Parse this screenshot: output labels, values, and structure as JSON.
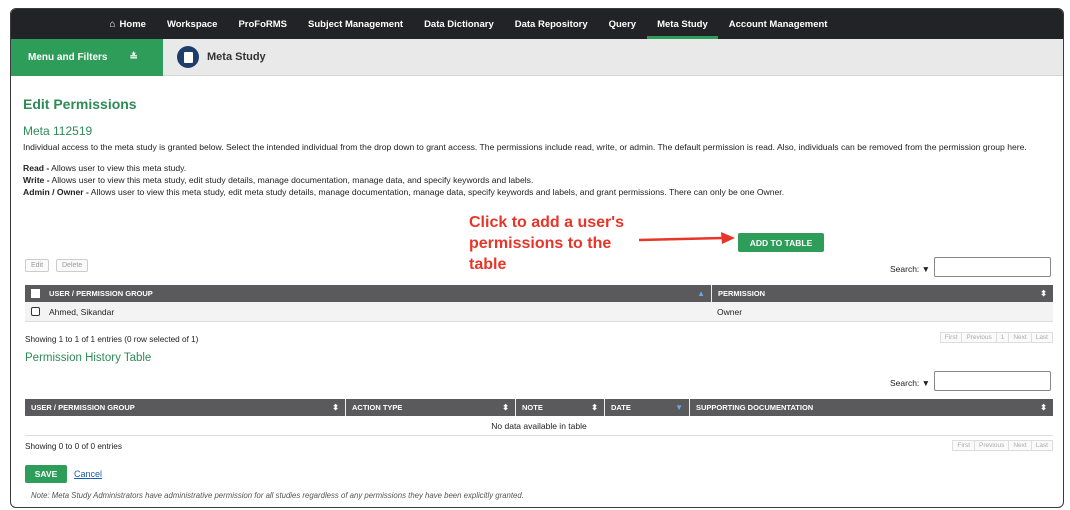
{
  "nav": {
    "items": [
      {
        "label": "Home",
        "icon": "home-icon",
        "active": false
      },
      {
        "label": "Workspace",
        "active": false
      },
      {
        "label": "ProFoRMS",
        "active": false
      },
      {
        "label": "Subject Management",
        "active": false
      },
      {
        "label": "Data Dictionary",
        "active": false
      },
      {
        "label": "Data Repository",
        "active": false
      },
      {
        "label": "Query",
        "active": false
      },
      {
        "label": "Meta Study",
        "active": true
      },
      {
        "label": "Account Management",
        "active": false
      }
    ]
  },
  "subbar": {
    "menu_filters_label": "Menu and Filters",
    "section_title": "Meta Study"
  },
  "page": {
    "title": "Edit Permissions",
    "meta_name": "Meta 112519",
    "description": "Individual access to the meta study is granted below. Select the intended individual from the drop down to grant access. The permissions include read, write, or admin. The default permission is read. Also, individuals can be removed from the permission group here.",
    "perm_read_term": "Read -",
    "perm_read_desc": " Allows user to view this meta study.",
    "perm_write_term": "Write -",
    "perm_write_desc": " Allows user to view this meta study, edit study details, manage documentation, manage data, and specify keywords and labels.",
    "perm_admin_term": "Admin / Owner -",
    "perm_admin_desc": " Allows user to view this meta study, edit meta study details, manage documentation, manage data, specify keywords and labels, and grant permissions. There can only be one Owner."
  },
  "annotation": {
    "line1": "Click to add a user's",
    "line2": "permissions to the",
    "line3": "table"
  },
  "perm_table": {
    "add_button": "ADD TO TABLE",
    "edit_button": "Edit",
    "delete_button": "Delete",
    "search_label": "Search:",
    "col_user": "USER / PERMISSION GROUP",
    "col_permission": "PERMISSION",
    "rows": [
      {
        "user": "Ahmed, Sikandar",
        "permission": "Owner"
      }
    ],
    "info": "Showing 1 to 1 of 1 entries (0 row selected of 1)",
    "pager": [
      "First",
      "Previous",
      "1",
      "Next",
      "Last"
    ]
  },
  "history_table": {
    "title": "Permission History Table",
    "search_label": "Search:",
    "col_user": "USER / PERMISSION GROUP",
    "col_action": "ACTION TYPE",
    "col_note": "NOTE",
    "col_date": "DATE",
    "col_docs": "SUPPORTING DOCUMENTATION",
    "empty": "No data available in table",
    "info": "Showing 0 to 0 of 0 entries",
    "pager": [
      "First",
      "Previous",
      "Next",
      "Last"
    ]
  },
  "footer": {
    "save": "SAVE",
    "cancel": "Cancel",
    "note": "Note: Meta Study Administrators have administrative permission for all studies regardless of any permissions they have been explicitly granted."
  },
  "colors": {
    "accent_green": "#2e9d5a",
    "nav_bg": "#222326",
    "annotation_red": "#e8352a"
  }
}
